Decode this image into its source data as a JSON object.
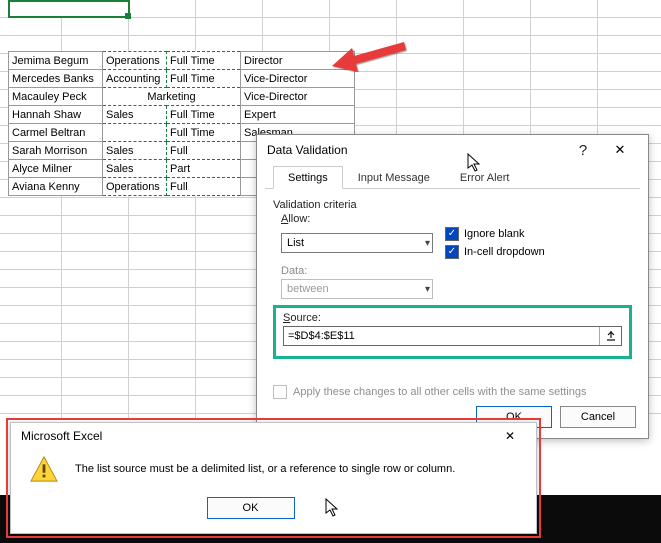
{
  "sheet": {
    "rows": [
      {
        "name": "Jemima Begum",
        "dept": "Operations",
        "time": "Full Time",
        "role": "Director"
      },
      {
        "name": "Mercedes Banks",
        "dept": "Accounting",
        "time": "Full Time",
        "role": "Vice-Director"
      },
      {
        "name": "Macauley Peck",
        "dept": "Marketing",
        "time": "",
        "role": "Vice-Director",
        "merged": true
      },
      {
        "name": "Hannah Shaw",
        "dept": "Sales",
        "time": "Full Time",
        "role": "Expert"
      },
      {
        "name": "Carmel Beltran",
        "dept": "",
        "time": "Full Time",
        "role": "Salesman"
      },
      {
        "name": "Sarah Morrison",
        "dept": "Sales",
        "time": "Full",
        "role": ""
      },
      {
        "name": "Alyce Milner",
        "dept": "Sales",
        "time": "Part",
        "role": ""
      },
      {
        "name": "Aviana Kenny",
        "dept": "Operations",
        "time": "Full",
        "role": ""
      }
    ]
  },
  "dialog": {
    "title": "Data Validation",
    "help": "?",
    "close": "✕",
    "tabs": {
      "settings": "Settings",
      "input": "Input Message",
      "error": "Error Alert"
    },
    "criteria_label": "Validation criteria",
    "allow_label": "Allow:",
    "allow_value": "List",
    "ignore_blank": "Ignore blank",
    "incell": "In-cell dropdown",
    "data_label": "Data:",
    "data_value": "between",
    "source_label": "Source:",
    "source_value": "=$D$4:$E$11",
    "apply_all": "Apply these changes to all other cells with the same settings",
    "ok": "OK",
    "cancel": "Cancel"
  },
  "msg": {
    "title": "Microsoft Excel",
    "close": "✕",
    "text": "The list source must be a delimited list, or a reference to single row or column.",
    "ok": "OK"
  }
}
